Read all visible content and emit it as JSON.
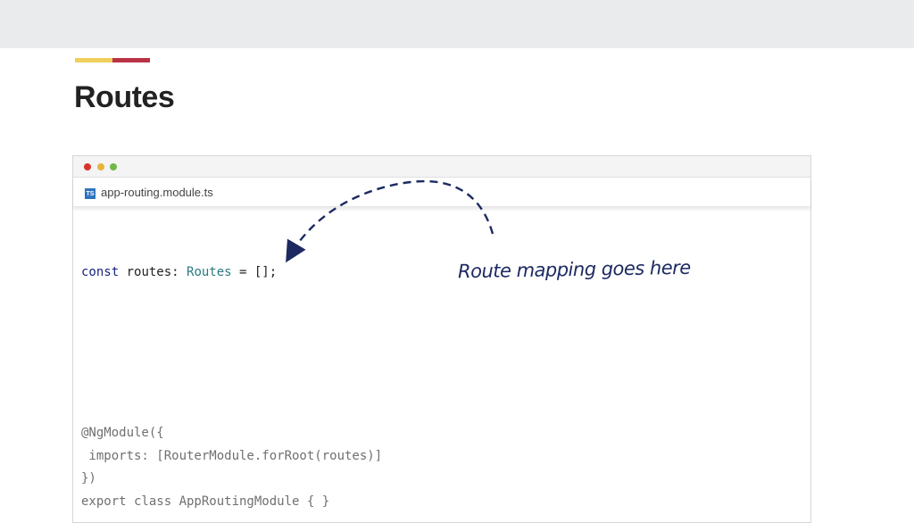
{
  "slide": {
    "title": "Routes"
  },
  "editor": {
    "file_name": "app-routing.module.ts",
    "file_icon_label": "TS",
    "code": {
      "line1": {
        "keyword": "const",
        "name": " routes: ",
        "type": "Routes",
        "rest": " = [];"
      },
      "ngmodule_lines": [
        "@NgModule({",
        " imports: [RouterModule.forRoot(routes)]",
        "})",
        "export class AppRoutingModule { }"
      ]
    }
  },
  "annotation": {
    "text": "Route mapping goes here"
  },
  "colors": {
    "accent_yellow": "#f0cf5a",
    "accent_red": "#b93346",
    "annotation": "#1d2a62",
    "keyword": "#1a237e",
    "type": "#2a7a80"
  }
}
